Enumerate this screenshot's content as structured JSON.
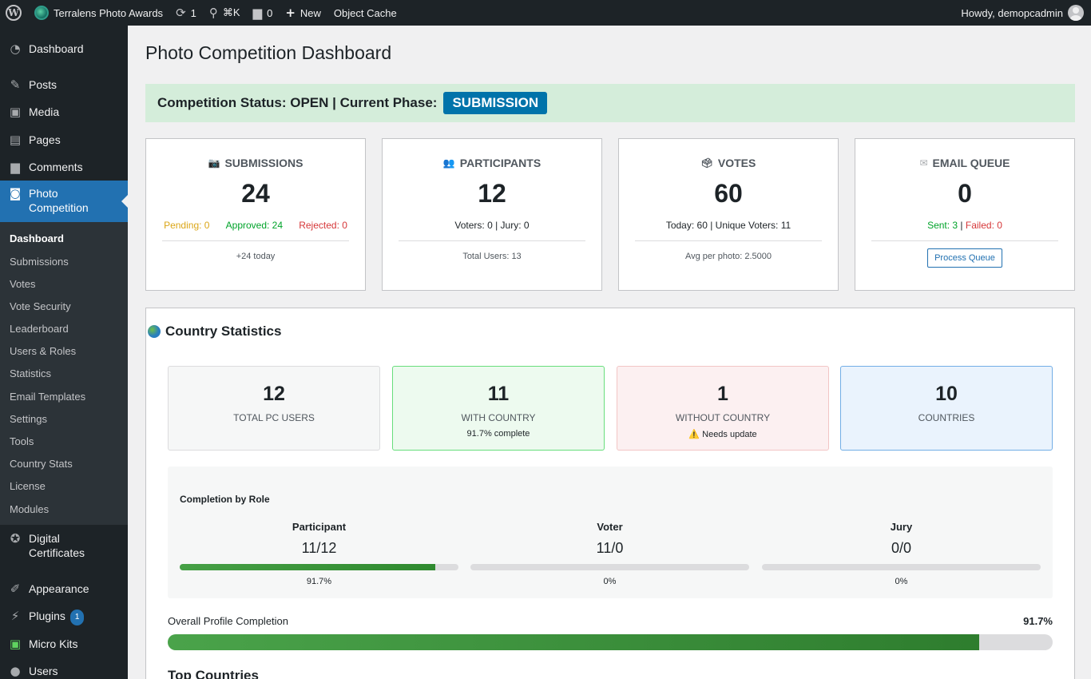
{
  "adminbar": {
    "site_name": "Terralens Photo Awards",
    "updates_count": "1",
    "search_shortcut": "⌘K",
    "comments_count": "0",
    "new_label": "New",
    "object_cache": "Object Cache",
    "howdy": "Howdy, demopcadmin"
  },
  "sidebar": {
    "dashboard": "Dashboard",
    "posts": "Posts",
    "media": "Media",
    "pages": "Pages",
    "comments": "Comments",
    "photo_competition": "Photo Competition",
    "submenu": [
      "Dashboard",
      "Submissions",
      "Votes",
      "Vote Security",
      "Leaderboard",
      "Users & Roles",
      "Statistics",
      "Email Templates",
      "Settings",
      "Tools",
      "Country Stats",
      "License",
      "Modules"
    ],
    "digital_certificates": "Digital Certificates",
    "appearance": "Appearance",
    "plugins": "Plugins",
    "plugins_badge": "1",
    "micro_kits": "Micro Kits",
    "users": "Users"
  },
  "page": {
    "title": "Photo Competition Dashboard",
    "status_text": "Competition Status: OPEN | Current Phase:",
    "phase": "SUBMISSION"
  },
  "cards": {
    "submissions": {
      "icon": "📷",
      "title": "SUBMISSIONS",
      "value": "24",
      "pending": "Pending: 0",
      "approved": "Approved: 24",
      "rejected": "Rejected: 0",
      "foot": "+24 today"
    },
    "participants": {
      "icon": "👥",
      "title": "PARTICIPANTS",
      "value": "12",
      "sub": "Voters: 0 | Jury: 0",
      "foot": "Total Users: 13"
    },
    "votes": {
      "icon": "🗳",
      "title": "VOTES",
      "value": "60",
      "sub": "Today: 60 | Unique Voters: 11",
      "foot": "Avg per photo: 2.5000"
    },
    "email": {
      "icon": "✉",
      "title": "EMAIL QUEUE",
      "value": "0",
      "sent": "Sent: 3",
      "sep": " | ",
      "failed": "Failed: 0",
      "button": "Process Queue"
    }
  },
  "country": {
    "title": "Country Statistics",
    "stats": [
      {
        "value": "12",
        "label": "TOTAL PC USERS",
        "note": ""
      },
      {
        "value": "11",
        "label": "WITH COUNTRY",
        "note": "91.7% complete"
      },
      {
        "value": "1",
        "label": "WITHOUT COUNTRY",
        "note": "⚠️ Needs update"
      },
      {
        "value": "10",
        "label": "COUNTRIES",
        "note": ""
      }
    ],
    "completion_heading": "Completion by Role",
    "roles": [
      {
        "name": "Participant",
        "value": "11/12",
        "pct": "91.7%",
        "fill": 0.917
      },
      {
        "name": "Voter",
        "value": "11/0",
        "pct": "0%",
        "fill": 0
      },
      {
        "name": "Jury",
        "value": "0/0",
        "pct": "0%",
        "fill": 0
      }
    ],
    "overall_label": "Overall Profile Completion",
    "overall_pct": "91.7%",
    "overall_fill": 0.917,
    "top_countries": "Top Countries"
  }
}
